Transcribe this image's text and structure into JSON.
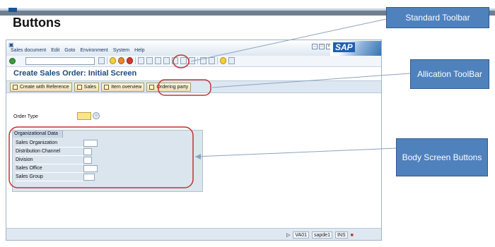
{
  "slide_title": "Buttons",
  "window": {
    "menus": [
      "Sales document",
      "Edit",
      "Goto",
      "Environment",
      "System",
      "Help"
    ],
    "sap_logo": "SAP",
    "screen_title": "Create Sales Order: Initial Screen"
  },
  "app_toolbar": {
    "buttons": [
      "Create with Reference",
      "Sales",
      "Item overview",
      "Ordering party"
    ]
  },
  "body": {
    "order_type_label": "Order Type",
    "org_tab_label": "Organizational Data",
    "org_fields": [
      "Sales Organization",
      "Distribution Channel",
      "Division",
      "Sales Office",
      "Sales Group"
    ]
  },
  "status_bar": {
    "transaction": "VA01",
    "server": "sapde1",
    "mode": "INS"
  },
  "callouts": {
    "standard_toolbar": "Standard Toolbar",
    "application_toolbar": "Allication ToolBar",
    "body_screen_buttons": "Body Screen Buttons"
  },
  "colors": {
    "callout_bg": "#4f81bd",
    "highlight_ring": "#c0352b",
    "title_blue": "#1c4a82"
  }
}
